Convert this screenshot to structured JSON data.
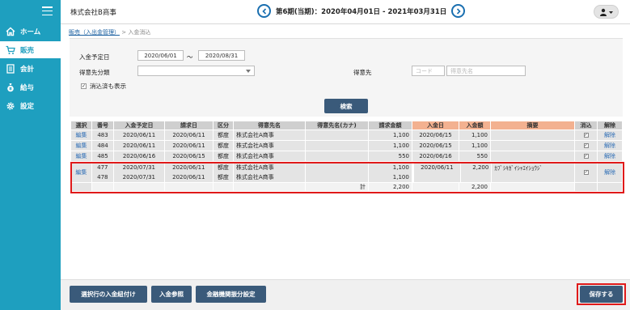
{
  "header": {
    "company": "株式会社B商事",
    "period": "第6期(当期)：2020年04月01日 - 2021年03月31日"
  },
  "sidebar": {
    "items": [
      {
        "label": "ホーム",
        "icon": "home-icon"
      },
      {
        "label": "販売",
        "icon": "cart-icon"
      },
      {
        "label": "会計",
        "icon": "ledger-icon"
      },
      {
        "label": "給与",
        "icon": "money-bag-icon"
      },
      {
        "label": "設定",
        "icon": "gear-icon"
      }
    ]
  },
  "breadcrumb": {
    "link": "販売（入出金管理）",
    "separator": " > ",
    "current": "入金消込"
  },
  "form": {
    "due_date_label": "入金予定日",
    "date_from": "2020/06/01",
    "tilde": "～",
    "date_to": "2020/08/31",
    "client_category_label": "得意先分類",
    "client_category_value": "",
    "client_label": "得意先",
    "code_placeholder": "コード",
    "name_placeholder": "得意先名",
    "show_cleared_label": "消込済も表示",
    "show_cleared_checked": "✓",
    "search_button": "検索"
  },
  "table": {
    "columns": [
      "選択",
      "番号",
      "入金予定日",
      "請求日",
      "区分",
      "得意先名",
      "得意先名(カナ)",
      "請求金額",
      "入金日",
      "入金額",
      "摘要",
      "消込",
      "解除"
    ],
    "rows": [
      {
        "select": "編集",
        "no": "483",
        "due": "2020/06/11",
        "billed": "2020/06/11",
        "type": "都度",
        "client": "株式会社A商事",
        "kana": "",
        "amount": "1,100",
        "paid_date": "2020/06/15",
        "paid": "1,100",
        "memo": "",
        "cleared": "✓",
        "cancel": "解除"
      },
      {
        "select": "編集",
        "no": "484",
        "due": "2020/06/11",
        "billed": "2020/06/11",
        "type": "都度",
        "client": "株式会社A商事",
        "kana": "",
        "amount": "1,100",
        "paid_date": "2020/06/15",
        "paid": "1,100",
        "memo": "",
        "cleared": "✓",
        "cancel": "解除"
      },
      {
        "select": "編集",
        "no": "485",
        "due": "2020/06/16",
        "billed": "2020/06/15",
        "type": "都度",
        "client": "株式会社A商事",
        "kana": "",
        "amount": "550",
        "paid_date": "2020/06/16",
        "paid": "550",
        "memo": "",
        "cleared": "✓",
        "cancel": "解除"
      }
    ],
    "group": {
      "select": "編集",
      "rows": [
        {
          "no": "477",
          "due": "2020/07/31",
          "billed": "2020/06/11",
          "type": "都度",
          "client": "株式会社A商事",
          "kana": "",
          "amount": "1,100"
        },
        {
          "no": "478",
          "due": "2020/07/31",
          "billed": "2020/06/11",
          "type": "都度",
          "client": "株式会社A商事",
          "kana": "",
          "amount": "1,100"
        }
      ],
      "paid_date": "2020/06/11",
      "paid": "2,200",
      "memo": "ｶﾌﾞｼｷｶﾞｲｼｬｴｲｼｮｳｼﾞ",
      "cleared": "✓",
      "cancel": "解除",
      "total_label": "計",
      "total_amount": "2,200",
      "total_paid": "2,200"
    }
  },
  "footer": {
    "assign_button": "選択行の入金紐付け",
    "payment_ref_button": "入金参照",
    "bank_button": "金融機関振分設定",
    "save_button": "保存する"
  },
  "colors": {
    "sidebar": "#1e9fbf",
    "button": "#3a5a7a",
    "header_orange": "#f3b190",
    "highlight": "#e01a1a"
  }
}
